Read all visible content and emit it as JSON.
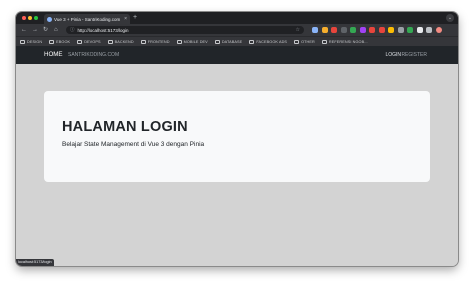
{
  "browser": {
    "tab_title": "Vue 3 + Pinia - SantriKoding.com",
    "tab_close": "×",
    "new_tab": "+",
    "tab_menu": "⌄",
    "url": "http://localhost:5173/login",
    "extension_colors": [
      "#8ab4f8",
      "#f6ae2d",
      "#e8453c",
      "#5f6368",
      "#34a853",
      "#a142f4",
      "#e8453c",
      "#e8453c",
      "#fbbc04",
      "#9aa0a6",
      "#34a853",
      "#e8eaed",
      "#bdc1c6",
      "#f28b82"
    ],
    "bookmarks": [
      "DESIGN",
      "EBOOK",
      "DEVOPS",
      "BACKEND",
      "FRONTEND",
      "MOBILE DEV",
      "DATABASE",
      "FACEBOOK ADS",
      "OTHER",
      "REFERENSI NGOB..."
    ],
    "status_url": "localhost:5173/login"
  },
  "app": {
    "nav": {
      "home": "HOME",
      "site": "SANTRIKODING.COM",
      "login": "LOGIN",
      "register": "REGISTER"
    },
    "card": {
      "title": "HALAMAN LOGIN",
      "subtitle": "Belajar State Management di Vue 3 dengan Pinia"
    },
    "colors": {
      "navbar": "#212529",
      "page_bg": "#d3d3d3",
      "card_bg": "#f8f9fa"
    }
  }
}
